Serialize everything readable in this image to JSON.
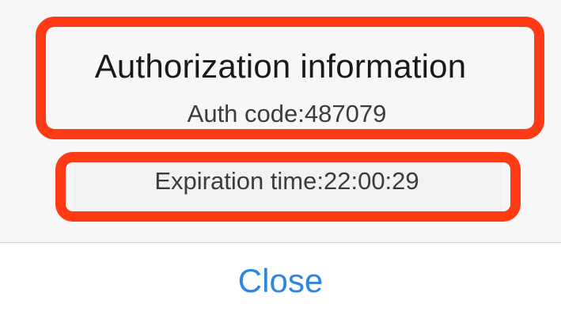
{
  "dialog": {
    "title": "Authorization information",
    "auth_code": "Auth code:487079",
    "expiration": "Expiration time:22:00:29",
    "close_label": "Close"
  },
  "colors": {
    "highlight": "#ff3b16",
    "close_text": "#2f86e0",
    "background": "#f7f7f7"
  }
}
